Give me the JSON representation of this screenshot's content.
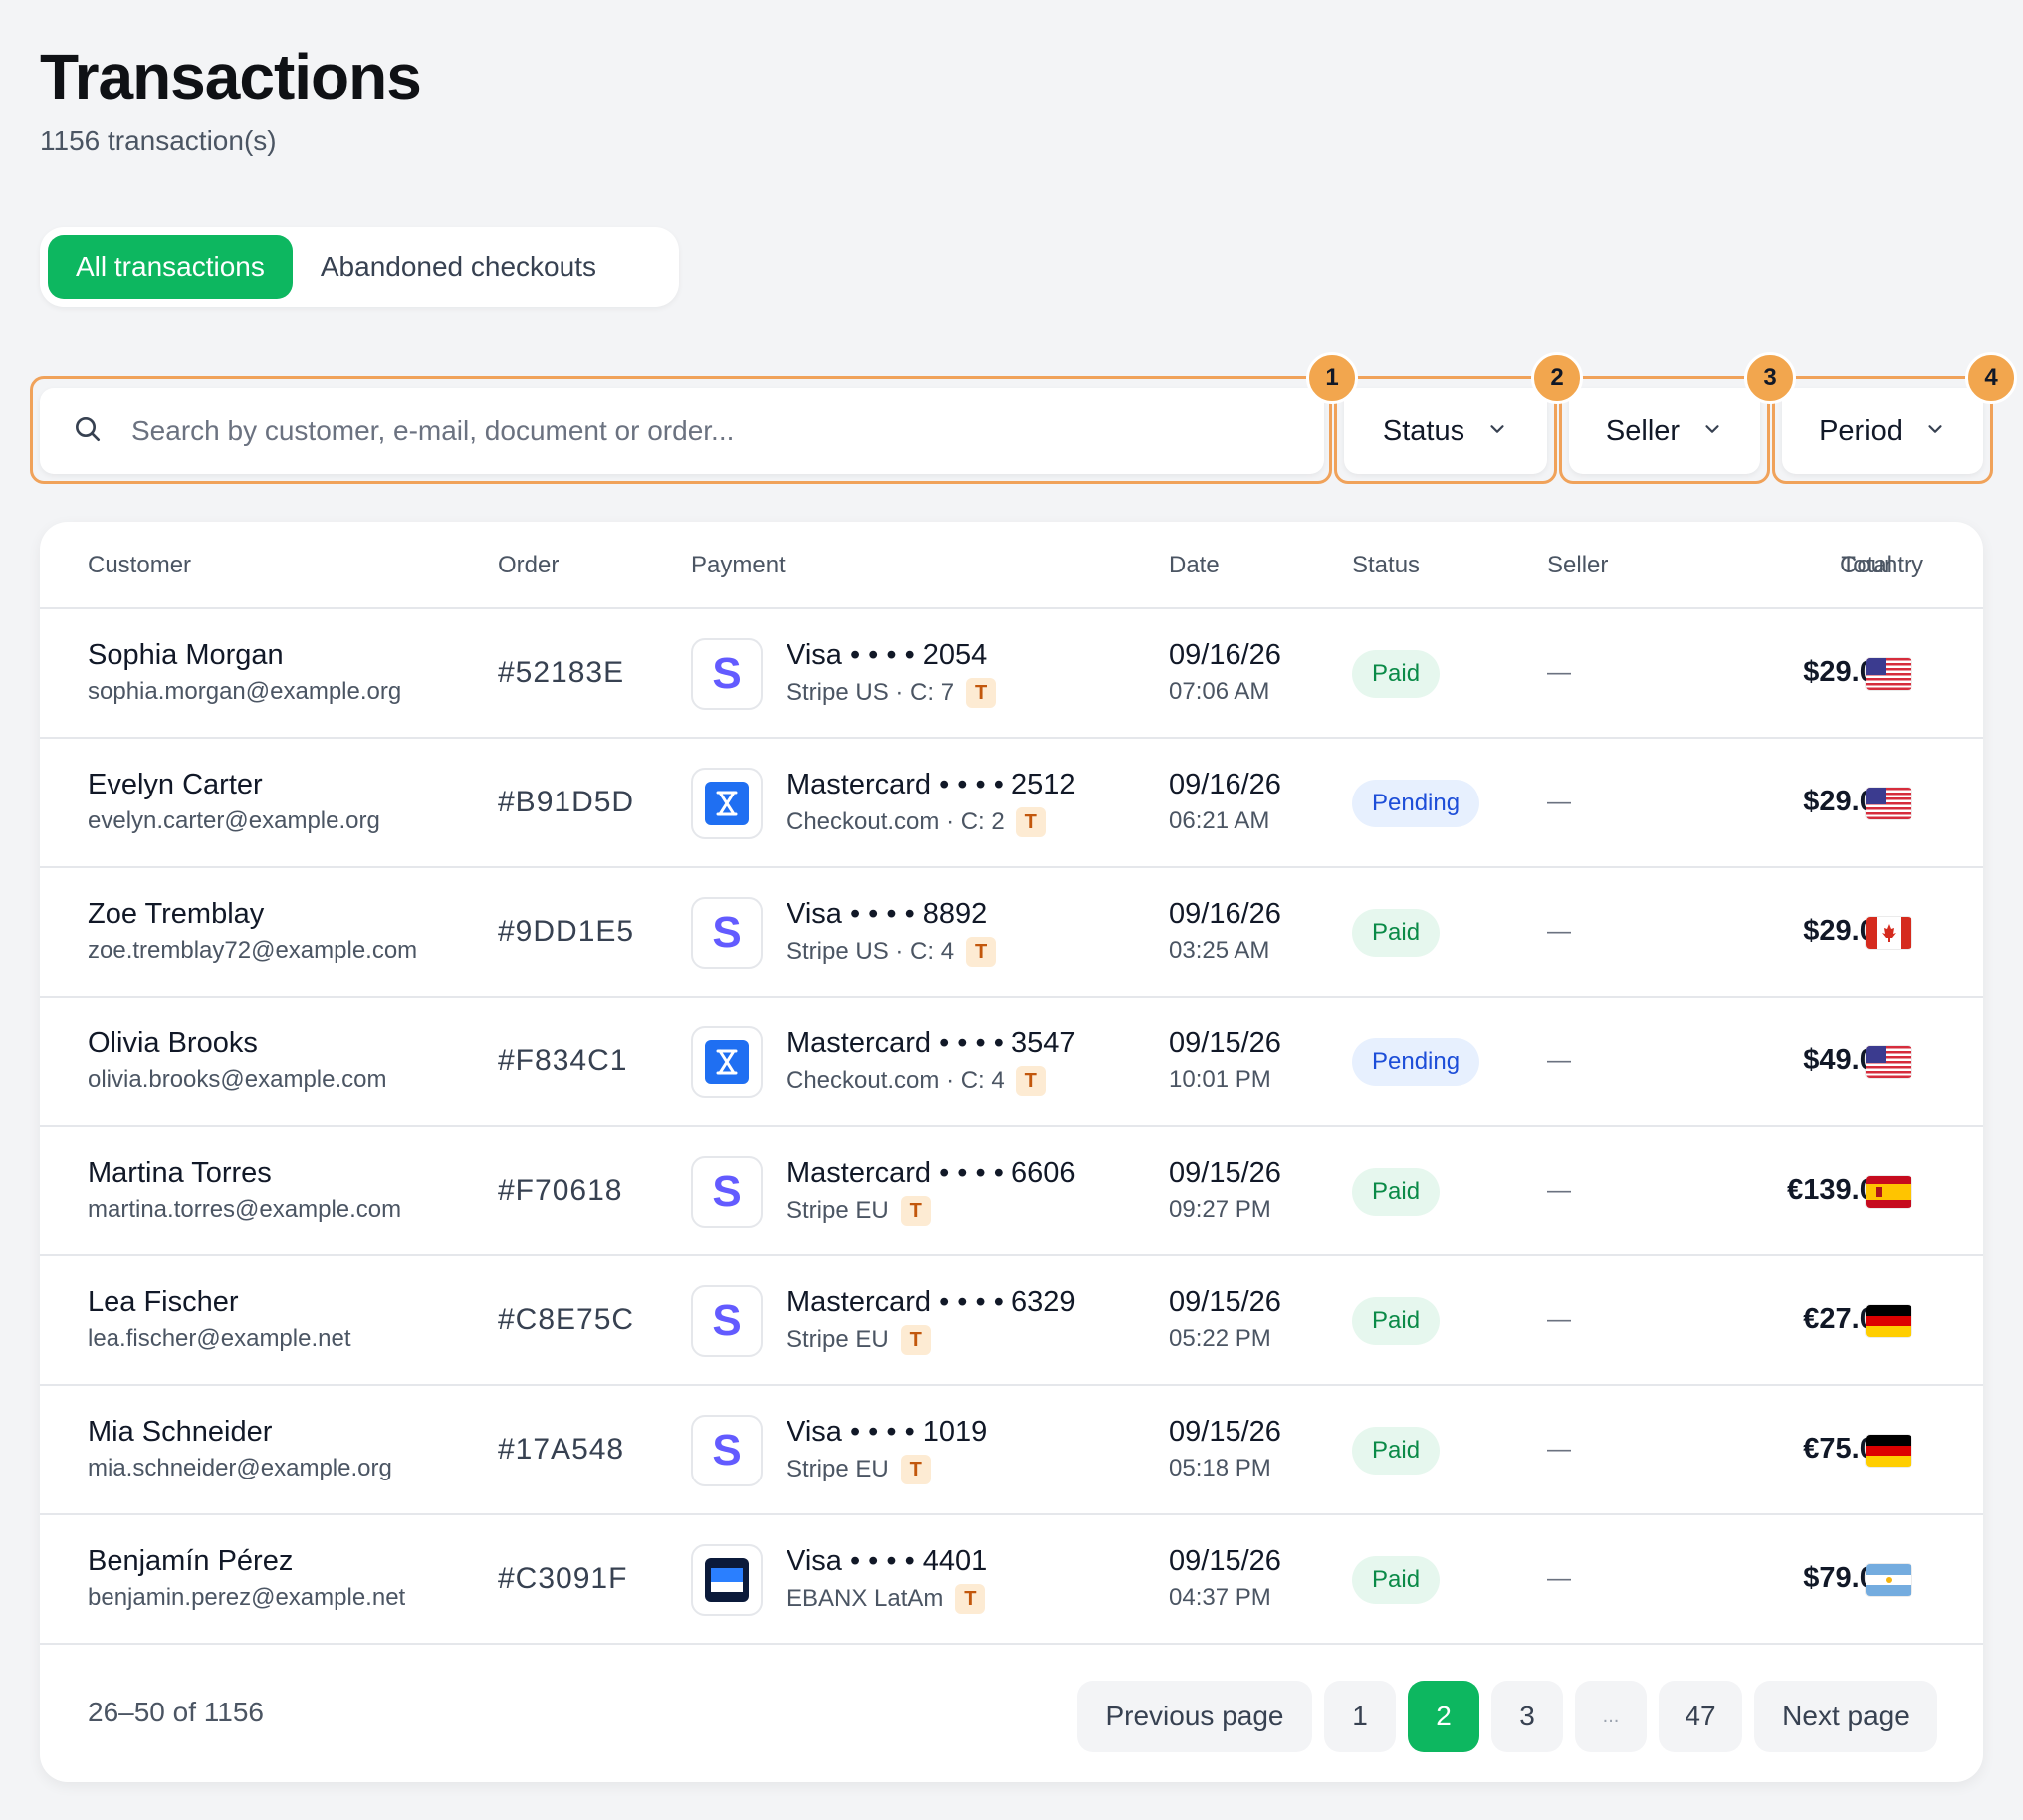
{
  "page": {
    "title": "Transactions",
    "subtitle": "1156 transaction(s)"
  },
  "tabs": [
    {
      "label": "All transactions",
      "active": true
    },
    {
      "label": "Abandoned checkouts",
      "active": false
    }
  ],
  "filters": {
    "search_placeholder": "Search by customer, e-mail, document or order...",
    "status_label": "Status",
    "seller_label": "Seller",
    "period_label": "Period",
    "markers": [
      "1",
      "2",
      "3",
      "4"
    ]
  },
  "table": {
    "headers": {
      "customer": "Customer",
      "order": "Order",
      "payment": "Payment",
      "date": "Date",
      "status": "Status",
      "seller": "Seller",
      "total": "Total",
      "country": "Country"
    },
    "rows": [
      {
        "name": "Sophia Morgan",
        "email": "sophia.morgan@example.org",
        "order": "#52183E",
        "provider_icon": "stripe-icon",
        "card": "Visa • • • • 2054",
        "gateway": "Stripe US · C: 7",
        "tag": "T",
        "date": "09/16/26",
        "time": "07:06 AM",
        "status": "Paid",
        "seller": "—",
        "total": "$29.00",
        "country": "us-flag-icon"
      },
      {
        "name": "Evelyn Carter",
        "email": "evelyn.carter@example.org",
        "order": "#B91D5D",
        "provider_icon": "checkout-icon",
        "card": "Mastercard • • • • 2512",
        "gateway": "Checkout.com · C: 2",
        "tag": "T",
        "date": "09/16/26",
        "time": "06:21 AM",
        "status": "Pending",
        "seller": "—",
        "total": "$29.00",
        "country": "us-flag-icon"
      },
      {
        "name": "Zoe Tremblay",
        "email": "zoe.tremblay72@example.com",
        "order": "#9DD1E5",
        "provider_icon": "stripe-icon",
        "card": "Visa • • • • 8892",
        "gateway": "Stripe US · C: 4",
        "tag": "T",
        "date": "09/16/26",
        "time": "03:25 AM",
        "status": "Paid",
        "seller": "—",
        "total": "$29.00",
        "country": "ca-flag-icon"
      },
      {
        "name": "Olivia Brooks",
        "email": "olivia.brooks@example.com",
        "order": "#F834C1",
        "provider_icon": "checkout-icon",
        "card": "Mastercard • • • • 3547",
        "gateway": "Checkout.com · C: 4",
        "tag": "T",
        "date": "09/15/26",
        "time": "10:01 PM",
        "status": "Pending",
        "seller": "—",
        "total": "$49.00",
        "country": "us-flag-icon"
      },
      {
        "name": "Martina Torres",
        "email": "martina.torres@example.com",
        "order": "#F70618",
        "provider_icon": "stripe-icon",
        "card": "Mastercard • • • • 6606",
        "gateway": "Stripe EU",
        "tag": "T",
        "date": "09/15/26",
        "time": "09:27 PM",
        "status": "Paid",
        "seller": "—",
        "total": "€139.00",
        "country": "es-flag-icon"
      },
      {
        "name": "Lea Fischer",
        "email": "lea.fischer@example.net",
        "order": "#C8E75C",
        "provider_icon": "stripe-icon",
        "card": "Mastercard • • • • 6329",
        "gateway": "Stripe EU",
        "tag": "T",
        "date": "09/15/26",
        "time": "05:22 PM",
        "status": "Paid",
        "seller": "—",
        "total": "€27.00",
        "country": "de-flag-icon"
      },
      {
        "name": "Mia Schneider",
        "email": "mia.schneider@example.org",
        "order": "#17A548",
        "provider_icon": "stripe-icon",
        "card": "Visa • • • • 1019",
        "gateway": "Stripe EU",
        "tag": "T",
        "date": "09/15/26",
        "time": "05:18 PM",
        "status": "Paid",
        "seller": "—",
        "total": "€75.00",
        "country": "de-flag-icon"
      },
      {
        "name": "Benjamín Pérez",
        "email": "benjamin.perez@example.net",
        "order": "#C3091F",
        "provider_icon": "ebanx-icon",
        "card": "Visa • • • • 4401",
        "gateway": "EBANX LatAm",
        "tag": "T",
        "date": "09/15/26",
        "time": "04:37 PM",
        "status": "Paid",
        "seller": "—",
        "total": "$79.00",
        "country": "ar-flag-icon"
      }
    ]
  },
  "pagination": {
    "range": "26–50 of 1156",
    "previous": "Previous page",
    "next": "Next page",
    "pages": [
      "1",
      "2",
      "3",
      "...",
      "47"
    ],
    "current": "2"
  },
  "colors": {
    "accent": "#0db760",
    "highlight": "#f0a25a",
    "paid": "#0a8a47",
    "pending": "#1d4ed8"
  }
}
